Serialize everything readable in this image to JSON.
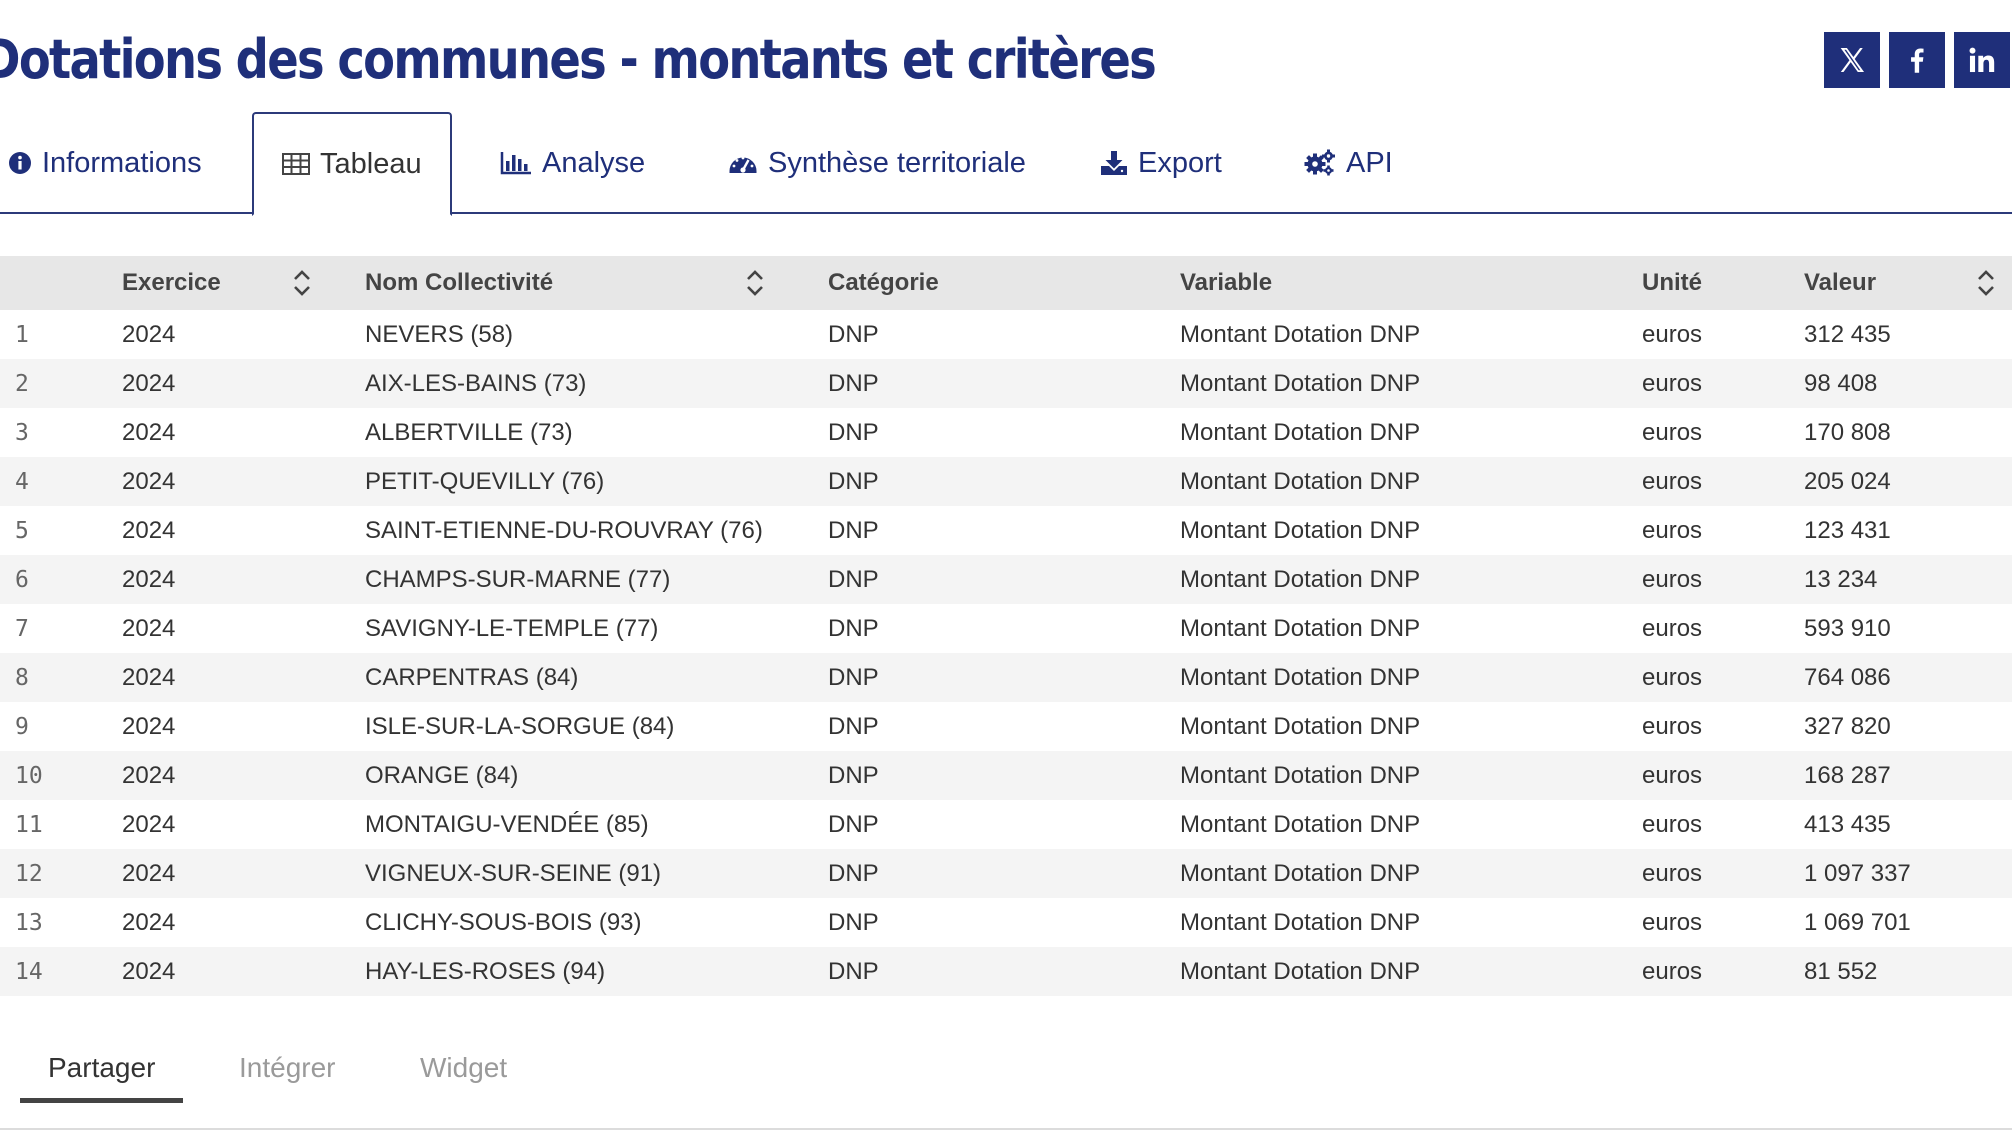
{
  "page": {
    "title": "Dotations des communes - montants et critères"
  },
  "social": [
    {
      "icon": "x-twitter-icon"
    },
    {
      "icon": "facebook-icon"
    },
    {
      "icon": "linkedin-icon"
    }
  ],
  "tabs": [
    {
      "label": "Informations",
      "icon": "info-circle-icon",
      "active": false
    },
    {
      "label": "Tableau",
      "icon": "table-icon",
      "active": true
    },
    {
      "label": "Analyse",
      "icon": "bar-chart-icon",
      "active": false
    },
    {
      "label": "Synthèse territoriale",
      "icon": "dashboard-gauge-icon",
      "active": false
    },
    {
      "label": "Export",
      "icon": "download-icon",
      "active": false
    },
    {
      "label": "API",
      "icon": "cogs-icon",
      "active": false
    }
  ],
  "table": {
    "columns": [
      "",
      "Exercice",
      "Nom Collectivité",
      "Catégorie",
      "Variable",
      "Unité",
      "Valeur"
    ],
    "rows": [
      [
        "1",
        "2024",
        "NEVERS (58)",
        "DNP",
        "Montant Dotation DNP",
        "euros",
        "312 435"
      ],
      [
        "2",
        "2024",
        "AIX-LES-BAINS (73)",
        "DNP",
        "Montant Dotation DNP",
        "euros",
        "98 408"
      ],
      [
        "3",
        "2024",
        "ALBERTVILLE (73)",
        "DNP",
        "Montant Dotation DNP",
        "euros",
        "170 808"
      ],
      [
        "4",
        "2024",
        "PETIT-QUEVILLY (76)",
        "DNP",
        "Montant Dotation DNP",
        "euros",
        "205 024"
      ],
      [
        "5",
        "2024",
        "SAINT-ETIENNE-DU-ROUVRAY (76)",
        "DNP",
        "Montant Dotation DNP",
        "euros",
        "123 431"
      ],
      [
        "6",
        "2024",
        "CHAMPS-SUR-MARNE (77)",
        "DNP",
        "Montant Dotation DNP",
        "euros",
        "13 234"
      ],
      [
        "7",
        "2024",
        "SAVIGNY-LE-TEMPLE (77)",
        "DNP",
        "Montant Dotation DNP",
        "euros",
        "593 910"
      ],
      [
        "8",
        "2024",
        "CARPENTRAS (84)",
        "DNP",
        "Montant Dotation DNP",
        "euros",
        "764 086"
      ],
      [
        "9",
        "2024",
        "ISLE-SUR-LA-SORGUE (84)",
        "DNP",
        "Montant Dotation DNP",
        "euros",
        "327 820"
      ],
      [
        "10",
        "2024",
        "ORANGE (84)",
        "DNP",
        "Montant Dotation DNP",
        "euros",
        "168 287"
      ],
      [
        "11",
        "2024",
        "MONTAIGU-VENDÉE (85)",
        "DNP",
        "Montant Dotation DNP",
        "euros",
        "413 435"
      ],
      [
        "12",
        "2024",
        "VIGNEUX-SUR-SEINE (91)",
        "DNP",
        "Montant Dotation DNP",
        "euros",
        "1 097 337"
      ],
      [
        "13",
        "2024",
        "CLICHY-SOUS-BOIS (93)",
        "DNP",
        "Montant Dotation DNP",
        "euros",
        "1 069 701"
      ],
      [
        "14",
        "2024",
        "HAY-LES-ROSES (94)",
        "DNP",
        "Montant Dotation DNP",
        "euros",
        "81 552"
      ]
    ]
  },
  "share": {
    "tabs": [
      {
        "label": "Partager",
        "active": true
      },
      {
        "label": "Intégrer",
        "active": false
      },
      {
        "label": "Widget",
        "active": false
      }
    ]
  },
  "colors": {
    "brand": "#1f2f7a",
    "header_bg": "#e7e7e7",
    "row_alt_bg": "#f4f4f4",
    "text": "#333333"
  }
}
